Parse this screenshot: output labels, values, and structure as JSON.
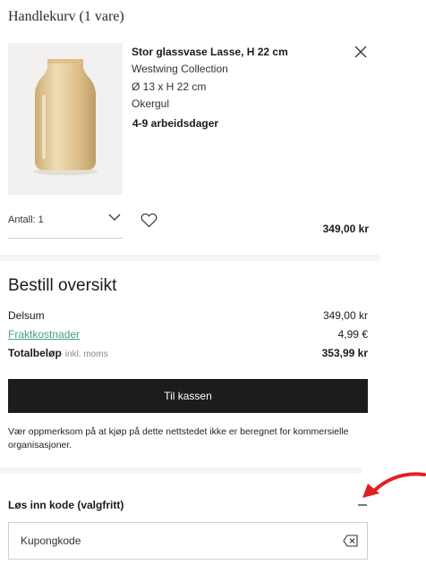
{
  "cart": {
    "title": "Handlekurv (1 vare)"
  },
  "product": {
    "name": "Stor glassvase Lasse, H 22 cm",
    "brand": "Westwing Collection",
    "dimensions": "Ø 13 x H 22 cm",
    "color": "Okergul",
    "delivery": "4-9 arbeidsdager",
    "quantity_label": "Antall: 1",
    "price": "349,00 kr"
  },
  "overview": {
    "title": "Bestill oversikt",
    "subtotal_label": "Delsum",
    "subtotal_value": "349,00 kr",
    "shipping_label": "Fraktkostnader",
    "shipping_value": "4,99 €",
    "total_label": "Totalbeløp",
    "total_note": "inkl. moms",
    "total_value": "353,99 kr",
    "checkout_label": "Til kassen",
    "notice": "Vær oppmerksom på at kjøp på dette nettstedet ikke er beregnet for kommersielle organisasjoner."
  },
  "coupon": {
    "header": "Løs inn kode (valgfritt)",
    "placeholder": "Kupongkode"
  },
  "colors": {
    "checkout_bg": "#1c1c1c",
    "link": "#3f9e8c",
    "annotation_arrow": "#e02020"
  },
  "icons": [
    "close-icon",
    "chevron-down-icon",
    "heart-icon",
    "minus-icon",
    "backspace-icon",
    "red-arrow-annotation"
  ]
}
